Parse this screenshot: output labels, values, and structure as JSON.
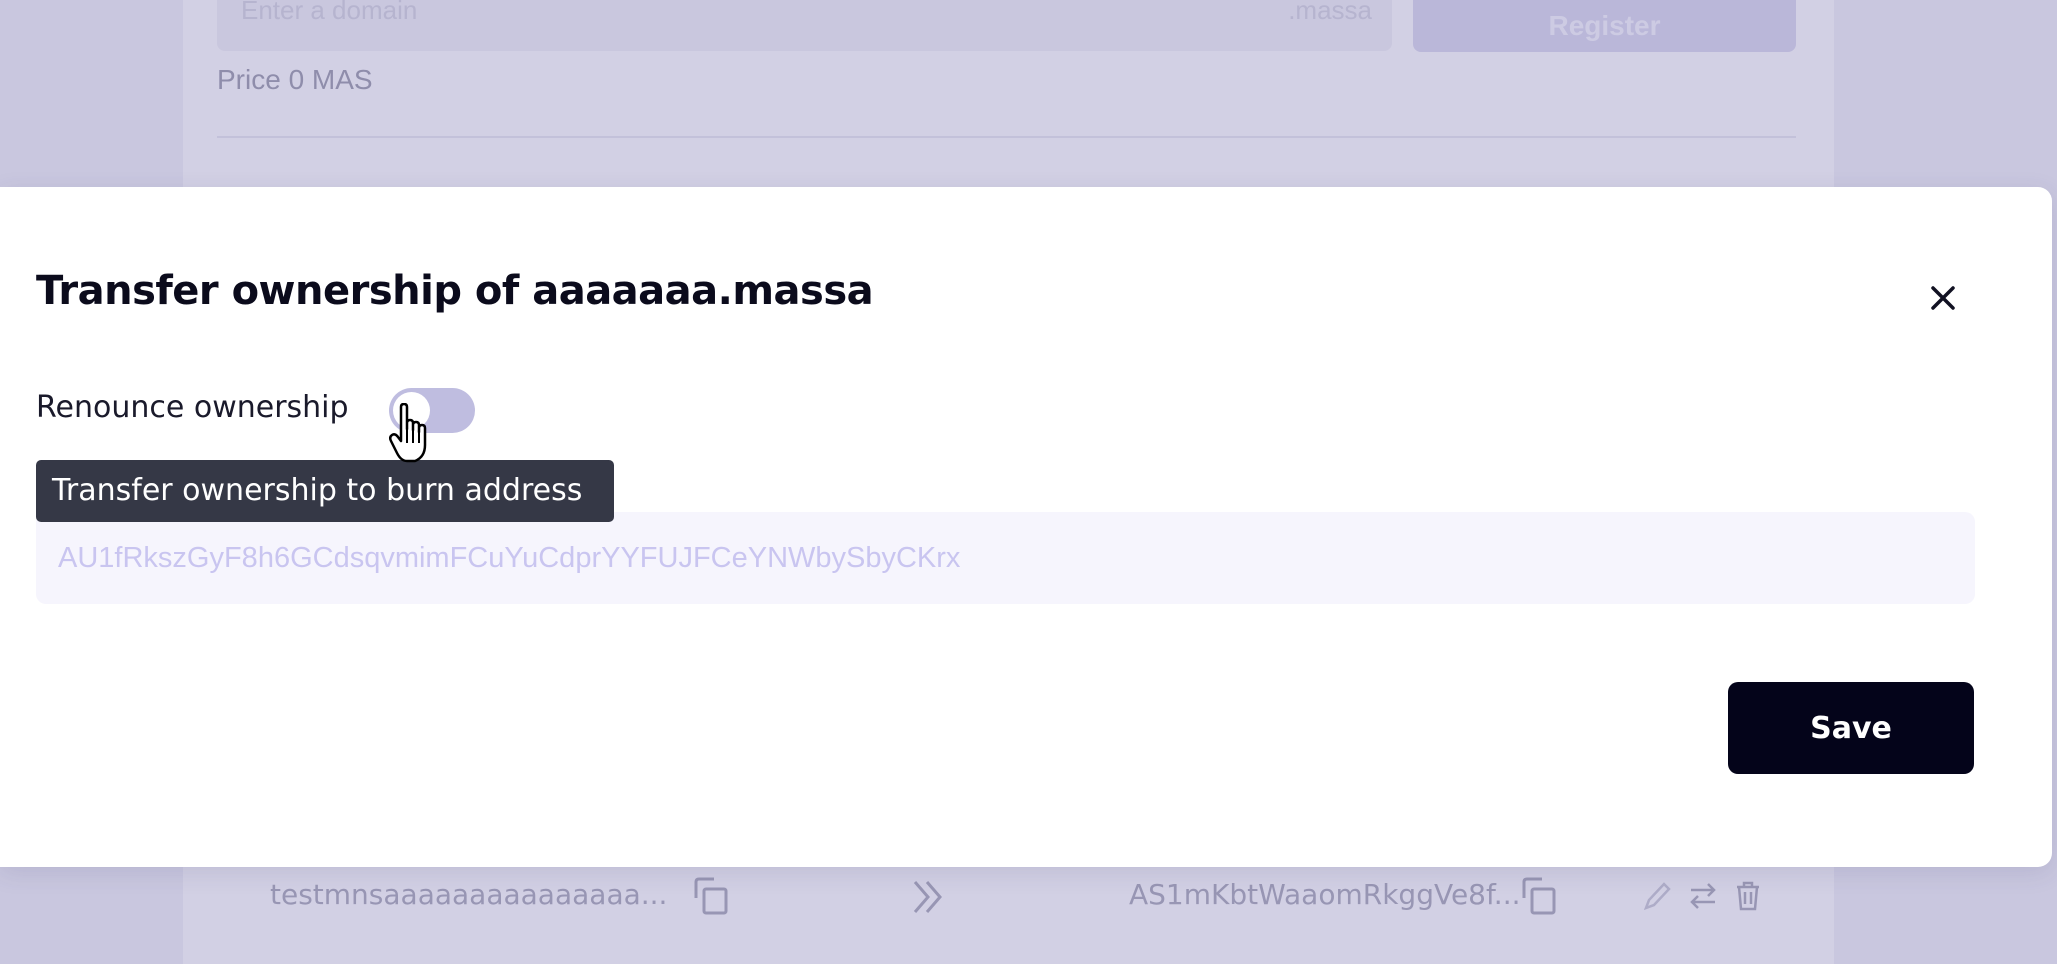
{
  "background": {
    "domain_input_placeholder": "Enter a domain",
    "domain_suffix": ".massa",
    "register_label": "Register",
    "price_text": "Price 0 MAS",
    "table_row": {
      "domain": "testmnsaaaaaaaaaaaaaaa...",
      "address": "AS1mKbtWaaomRkggVe8f..."
    }
  },
  "modal": {
    "title": "Transfer ownership of aaaaaaa.massa",
    "renounce_label": "Renounce ownership",
    "renounce_checked": false,
    "tooltip": "Transfer ownership to burn address",
    "address_placeholder": "AU1fRkszGyF8h6GCdsqvmimFCuYuCdprYYFUJFCeYNWbySbyCKrx",
    "address_value": "",
    "save_label": "Save"
  },
  "colors": {
    "overlay": "#c9c7df",
    "save_button": "#04041a",
    "toggle_track": "#bfbde0",
    "tooltip_bg": "#353846",
    "input_bg": "#f6f5fd",
    "placeholder": "#c9c5f0"
  },
  "icons": [
    "close-icon",
    "copy-icon",
    "double-chevron-right-icon",
    "pencil-icon",
    "swap-icon",
    "trash-icon",
    "hand-pointer-icon"
  ]
}
